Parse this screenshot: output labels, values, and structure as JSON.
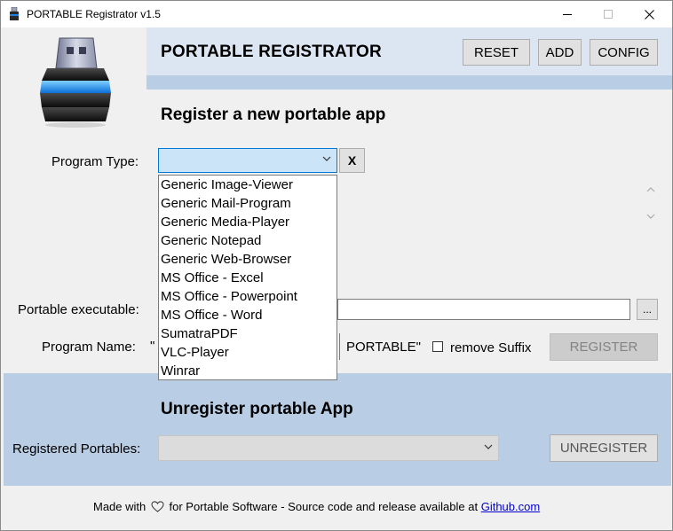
{
  "window": {
    "title": "PORTABLE Registrator v1.5",
    "min_glyph": "—",
    "max_glyph": "☐",
    "close_glyph": "✕"
  },
  "header": {
    "title": "PORTABLE REGISTRATOR",
    "reset_label": "RESET",
    "add_label": "ADD",
    "config_label": "CONFIG"
  },
  "register": {
    "section_title": "Register a new portable app",
    "program_type_label": "Program Type:",
    "program_type_value": "",
    "clear_label": "X",
    "program_type_options": [
      "Generic Image-Viewer",
      "Generic Mail-Program",
      "Generic Media-Player",
      "Generic Notepad",
      "Generic Web-Browser",
      "MS Office - Excel",
      "MS Office - Powerpoint",
      "MS Office - Word",
      "SumatraPDF",
      "VLC-Player",
      "Winrar"
    ],
    "executable_label": "Portable executable:",
    "executable_value": "",
    "browse_label": "...",
    "program_name_label": "Program Name:",
    "quote_open": "\"",
    "suffix_text": "PORTABLE\"",
    "remove_suffix_label": "remove Suffix",
    "remove_suffix_checked": false,
    "register_label": "REGISTER"
  },
  "unregister": {
    "section_title": "Unregister portable App",
    "registered_label": "Registered Portables:",
    "registered_value": "",
    "unregister_label": "UNREGISTER"
  },
  "footer": {
    "made_with": "Made with",
    "middle_text": "for Portable Software - Source code and release available at",
    "link_text": "Github.com"
  },
  "colors": {
    "header_band": "#dce6f2",
    "accent_band": "#b9cde4",
    "focus_border": "#0078d7",
    "link": "#0000cc"
  }
}
